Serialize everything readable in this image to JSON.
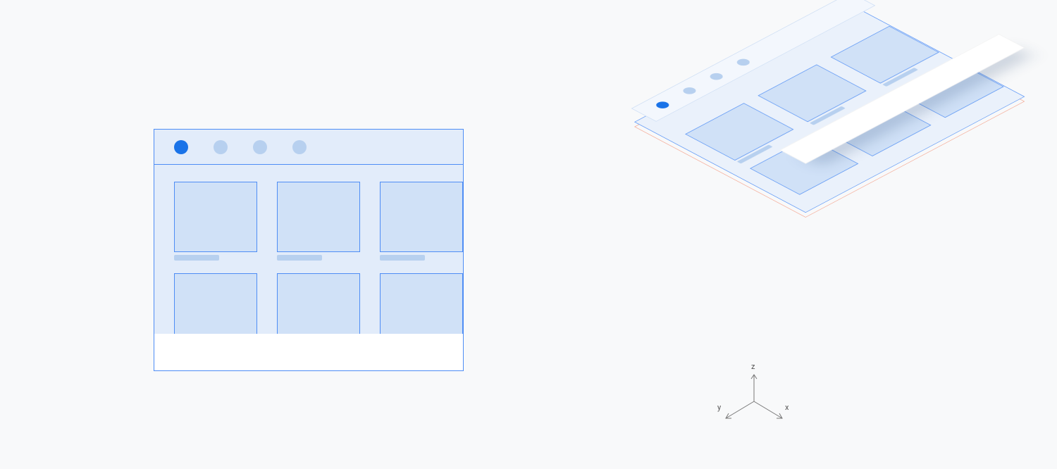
{
  "diagram": {
    "description": "Illustration contrasting a flat 2D browser window wireframe with its exploded 3D isometric layer view, including an XYZ axis gizmo.",
    "colors": {
      "background": "#f8f9fa",
      "outline_blue": "#4e8df5",
      "surface_light": "#e2ecfa",
      "surface_card": "#d0e1f7",
      "dot_inactive": "#b7d0ef",
      "dot_active": "#1a73e8",
      "outline_red": "#f4a28c",
      "overlay_white": "#ffffff"
    }
  },
  "flat_view": {
    "tabs": [
      {
        "active": true
      },
      {
        "active": false
      },
      {
        "active": false
      },
      {
        "active": false
      }
    ],
    "grid_columns": 3,
    "grid_rows_visible": 2,
    "cards_in_row": 3,
    "overlay_bar": true
  },
  "iso_view": {
    "layers": [
      "red-base-plane",
      "blue-surface",
      "tab-bar",
      "card-grid",
      "white-overlay-bar"
    ],
    "tabs": [
      {
        "active": true
      },
      {
        "active": false
      },
      {
        "active": false
      },
      {
        "active": false
      }
    ],
    "grid_columns": 3,
    "grid_rows_visible": 2
  },
  "axes": {
    "z": "z",
    "y": "y",
    "x": "x"
  }
}
